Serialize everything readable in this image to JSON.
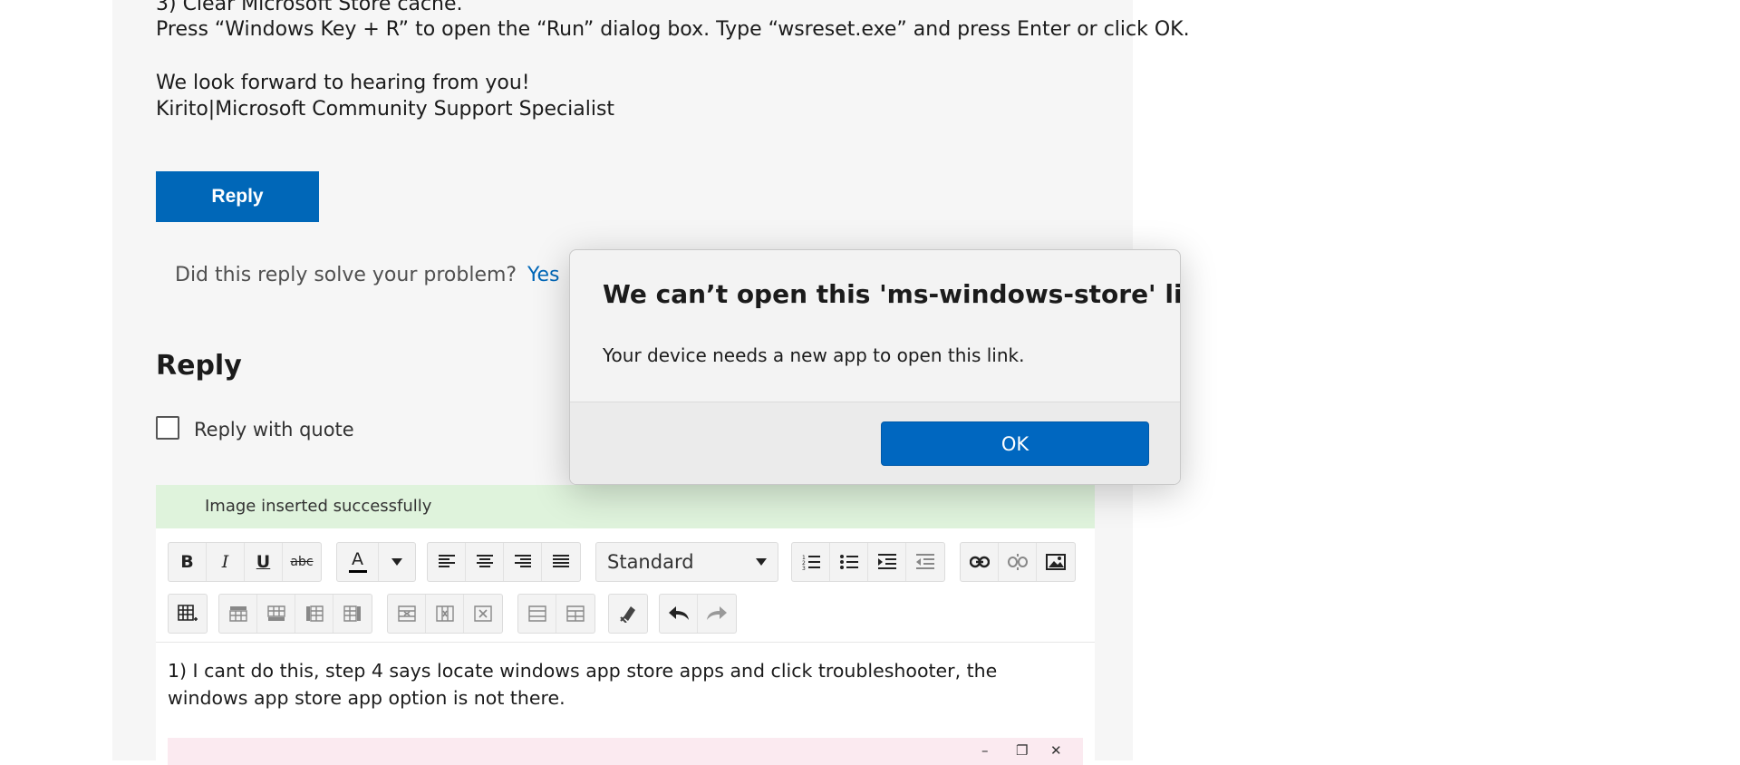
{
  "article": {
    "lines": [
      "3) Clear Microsoft Store cache.",
      "Press “Windows Key + R” to open the “Run” dialog box. Type “wsreset.exe” and press Enter or click OK.",
      "We look forward to hearing from you!",
      "Kirito|Microsoft Community Support Specialist"
    ],
    "reply_button": "Reply"
  },
  "feedback": {
    "question": "Did this reply solve your problem?",
    "yes": "Yes"
  },
  "reply_section": {
    "heading": "Reply",
    "quote_label": "Reply with quote",
    "success_message": "Image inserted successfully",
    "format_select": "Standard",
    "editor_text": "1) I cant do this, step 4 says locate windows app store apps and click troubleshooter, the windows app store app option is not there."
  },
  "toolbar": {
    "row1": [
      "bold-icon",
      "italic-icon",
      "underline-icon",
      "strikethrough-icon",
      "font-color-icon",
      "align-left-icon",
      "align-center-icon",
      "align-right-icon",
      "justify-icon",
      "numbered-list-icon",
      "bulleted-list-icon",
      "indent-icon",
      "outdent-icon",
      "link-icon",
      "unlink-icon",
      "image-icon"
    ],
    "row2": [
      "insert-table-icon",
      "row-above-icon",
      "row-below-icon",
      "column-left-icon",
      "column-right-icon",
      "delete-row-icon",
      "delete-column-icon",
      "delete-table-icon",
      "merge-cells-icon",
      "split-cells-icon",
      "clear-format-icon",
      "undo-icon",
      "redo-icon"
    ],
    "labels": {
      "bold": "B",
      "italic": "I",
      "underline": "U",
      "strike": "abc",
      "font_color": "A"
    }
  },
  "dialog": {
    "title": "We can’t open this 'ms-windows-store' link",
    "body": "Your device needs a new app to open this link.",
    "ok": "OK"
  },
  "colors": {
    "accent": "#0067b8",
    "success_bg": "#dff3dc"
  }
}
